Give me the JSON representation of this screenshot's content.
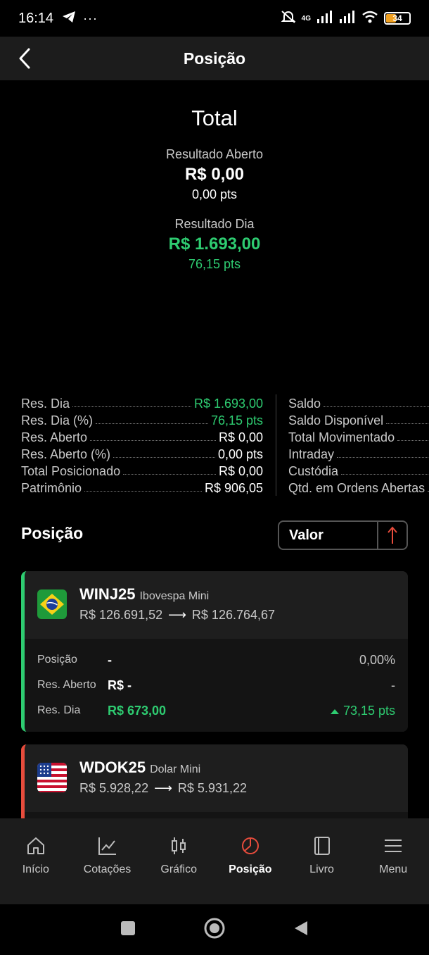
{
  "status": {
    "time": "16:14",
    "battery": "34",
    "network": "4G"
  },
  "header": {
    "title": "Posição"
  },
  "total": {
    "title": "Total",
    "aberto_label": "Resultado Aberto",
    "aberto_value": "R$ 0,00",
    "aberto_pts": "0,00 pts",
    "dia_label": "Resultado Dia",
    "dia_value": "R$ 1.693,00",
    "dia_pts": "76,15 pts"
  },
  "summary_left": [
    {
      "label": "Res. Dia",
      "value": "R$ 1.693,00",
      "positive": true
    },
    {
      "label": "Res. Dia (%)",
      "value": "76,15 pts",
      "positive": true
    },
    {
      "label": "Res. Aberto",
      "value": "R$ 0,00",
      "positive": false
    },
    {
      "label": "Res. Aberto (%)",
      "value": "0,00 pts",
      "positive": false
    },
    {
      "label": "Total Posicionado",
      "value": "R$ 0,00",
      "positive": false
    },
    {
      "label": "Patrimônio",
      "value": "R$ 906,05",
      "positive": false
    }
  ],
  "summary_right": [
    {
      "label": "Saldo"
    },
    {
      "label": "Saldo Disponível"
    },
    {
      "label": "Total Movimentado"
    },
    {
      "label": "Intraday"
    },
    {
      "label": "Custódia"
    },
    {
      "label": "Qtd. em Ordens Abertas"
    }
  ],
  "positions": {
    "title": "Posição",
    "sort_value": "Valor",
    "cards": [
      {
        "symbol": "WINJ25",
        "name": "Ibovespa Mini",
        "from": "R$ 126.691,52",
        "to": "R$ 126.764,67",
        "posicao_label": "Posição",
        "posicao_value": "-",
        "posicao_pct": "0,00%",
        "aberto_label": "Res. Aberto",
        "aberto_value": "R$ -",
        "aberto_right": "-",
        "dia_label": "Res. Dia",
        "dia_value": "R$ 673,00",
        "dia_pts": "73,15 pts",
        "accent": "#2ecc71"
      },
      {
        "symbol": "WDOK25",
        "name": "Dolar Mini",
        "from": "R$ 5.928,22",
        "to": "R$ 5.931,22",
        "accent": "#e74c3c"
      }
    ]
  },
  "nav": [
    {
      "label": "Início",
      "icon": "home-icon"
    },
    {
      "label": "Cotações",
      "icon": "chart-line-icon"
    },
    {
      "label": "Gráfico",
      "icon": "candlestick-icon"
    },
    {
      "label": "Posição",
      "icon": "pie-chart-icon",
      "active": true
    },
    {
      "label": "Livro",
      "icon": "book-icon"
    },
    {
      "label": "Menu",
      "icon": "menu-icon"
    }
  ]
}
